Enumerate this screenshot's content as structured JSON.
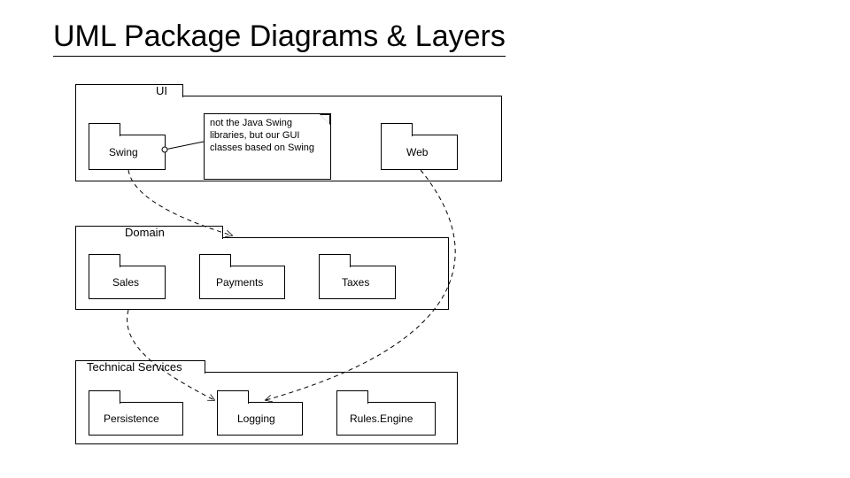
{
  "title": "UML Package Diagrams & Layers",
  "layers": {
    "ui": {
      "name": "UI",
      "packages": {
        "swing": "Swing",
        "web": "Web"
      },
      "note": "not the Java Swing libraries, but our GUI classes based on Swing"
    },
    "domain": {
      "name": "Domain",
      "packages": {
        "sales": "Sales",
        "payments": "Payments",
        "taxes": "Taxes"
      }
    },
    "tech": {
      "name": "Technical Services",
      "packages": {
        "persistence": "Persistence",
        "logging": "Logging",
        "rules": "Rules.Engine"
      }
    }
  }
}
